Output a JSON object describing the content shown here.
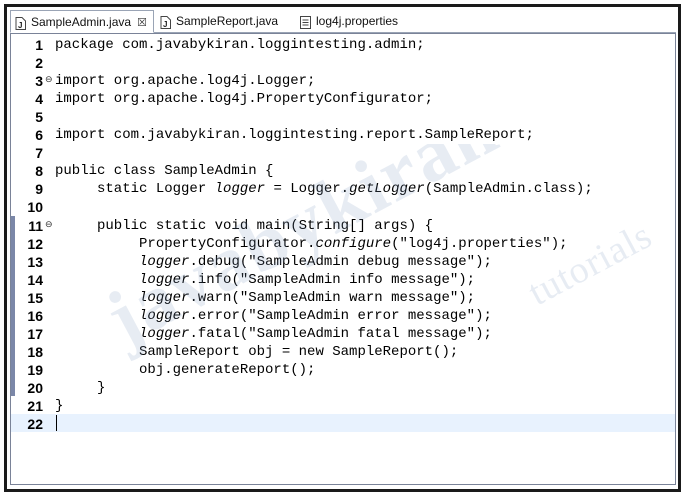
{
  "tabs": [
    {
      "label": "SampleAdmin.java",
      "icon": "java-file-icon",
      "active": true,
      "closable": true
    },
    {
      "label": "SampleReport.java",
      "icon": "java-file-icon",
      "active": false
    },
    {
      "label": "log4j.properties",
      "icon": "properties-file-icon",
      "active": false
    }
  ],
  "close_glyph": "☒",
  "editor": {
    "current_line": 22,
    "folds": [
      3,
      11
    ],
    "line_numbers": [
      "1",
      "2",
      "3",
      "4",
      "5",
      "6",
      "7",
      "8",
      "9",
      "10",
      "11",
      "12",
      "13",
      "14",
      "15",
      "16",
      "17",
      "18",
      "19",
      "20",
      "21",
      "22"
    ],
    "lines": [
      [
        {
          "t": "package com.javabykiran.loggintesting.admin;"
        }
      ],
      [],
      [
        {
          "t": "import org.apache.log4j.Logger;"
        }
      ],
      [
        {
          "t": "import org.apache.log4j.PropertyConfigurator;"
        }
      ],
      [],
      [
        {
          "t": "import com.javabykiran.loggintesting.report.SampleReport;"
        }
      ],
      [],
      [
        {
          "t": "public class SampleAdmin {"
        }
      ],
      [
        {
          "t": "     static Logger "
        },
        {
          "t": "logger",
          "i": true
        },
        {
          "t": " = Logger."
        },
        {
          "t": "getLogger",
          "i": true
        },
        {
          "t": "(SampleAdmin.class);"
        }
      ],
      [],
      [
        {
          "t": "     public static void main(String[] args) {"
        }
      ],
      [
        {
          "t": "          PropertyConfigurator."
        },
        {
          "t": "configure",
          "i": true
        },
        {
          "t": "(\"log4j.properties\");"
        }
      ],
      [
        {
          "t": "          "
        },
        {
          "t": "logger",
          "i": true
        },
        {
          "t": ".debug(\"SampleAdmin debug message\");"
        }
      ],
      [
        {
          "t": "          "
        },
        {
          "t": "logger",
          "i": true
        },
        {
          "t": ".info(\"SampleAdmin info message\");"
        }
      ],
      [
        {
          "t": "          "
        },
        {
          "t": "logger",
          "i": true
        },
        {
          "t": ".warn(\"SampleAdmin warn message\");"
        }
      ],
      [
        {
          "t": "          "
        },
        {
          "t": "logger",
          "i": true
        },
        {
          "t": ".error(\"SampleAdmin error message\");"
        }
      ],
      [
        {
          "t": "          "
        },
        {
          "t": "logger",
          "i": true
        },
        {
          "t": ".fatal(\"SampleAdmin fatal message\");"
        }
      ],
      [
        {
          "t": "          SampleReport obj = new SampleReport();"
        }
      ],
      [
        {
          "t": "          obj.generateReport();"
        }
      ],
      [
        {
          "t": "     }"
        }
      ],
      [
        {
          "t": "}"
        }
      ],
      []
    ]
  },
  "watermark": {
    "main": "javabykiran",
    "sub": "tutorials"
  },
  "colors": {
    "fold_band": "#7b87a8",
    "current_line": "#e8f2fe",
    "tab_border": "#9aa4b5"
  }
}
